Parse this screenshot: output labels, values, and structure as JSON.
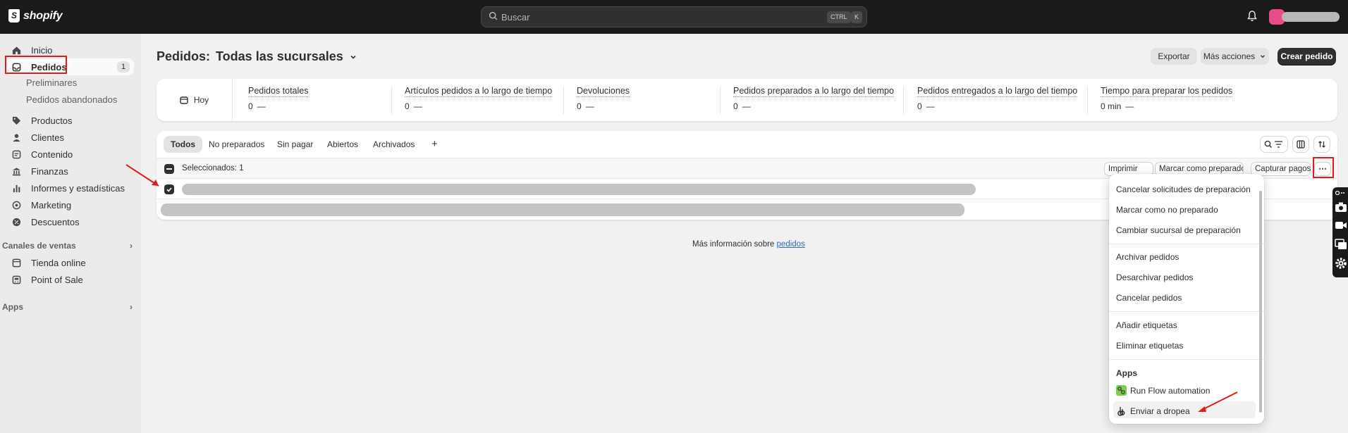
{
  "topbar": {
    "brand": "shopify",
    "search_placeholder": "Buscar",
    "shortcut_ctrl": "CTRL",
    "shortcut_k": "K"
  },
  "sidebar": {
    "items": [
      {
        "label": "Inicio",
        "icon": "home-icon"
      },
      {
        "label": "Pedidos",
        "icon": "inbox-icon",
        "badge": "1",
        "active": true
      },
      {
        "label": "Productos",
        "icon": "tag-icon"
      },
      {
        "label": "Clientes",
        "icon": "person-icon"
      },
      {
        "label": "Contenido",
        "icon": "content-icon"
      },
      {
        "label": "Finanzas",
        "icon": "bank-icon"
      },
      {
        "label": "Informes y estadísticas",
        "icon": "bar-chart-icon"
      },
      {
        "label": "Marketing",
        "icon": "target-icon"
      },
      {
        "label": "Descuentos",
        "icon": "discount-icon"
      }
    ],
    "sub_items": [
      "Preliminares",
      "Pedidos abandonados"
    ],
    "sales_channels_label": "Canales de ventas",
    "channels": [
      {
        "label": "Tienda online",
        "icon": "store-icon"
      },
      {
        "label": "Point of Sale",
        "icon": "pos-icon"
      }
    ],
    "apps_label": "Apps"
  },
  "page": {
    "title": "Pedidos:",
    "location": "Todas las sucursales",
    "export_label": "Exportar",
    "more_actions_label": "Más acciones",
    "create_label": "Crear pedido"
  },
  "metrics": {
    "period": "Hoy",
    "items": [
      {
        "label": "Pedidos totales",
        "value": "0"
      },
      {
        "label": "Artículos pedidos a lo largo de tiempo",
        "value": "0"
      },
      {
        "label": "Devoluciones",
        "value": "0"
      },
      {
        "label": "Pedidos preparados a lo largo del tiempo",
        "value": "0"
      },
      {
        "label": "Pedidos entregados a lo largo del tiempo",
        "value": "0"
      },
      {
        "label": "Tiempo para preparar los pedidos",
        "value": "0 min"
      }
    ]
  },
  "tabs": [
    "Todos",
    "No preparados",
    "Sin pagar",
    "Abiertos",
    "Archivados"
  ],
  "add_tab_label": "+",
  "bulk": {
    "selected_label": "Seleccionados: 1",
    "print_label": "Imprimir",
    "mark_prepared_label": "Marcar como preparado",
    "capture_label": "Capturar pagos"
  },
  "footer_text": "Más información sobre",
  "footer_link": "pedidos",
  "menu": {
    "group1": [
      "Cancelar solicitudes de preparación",
      "Marcar como no preparado",
      "Cambiar sucursal de preparación"
    ],
    "group2": [
      "Archivar pedidos",
      "Desarchivar pedidos",
      "Cancelar pedidos"
    ],
    "group3": [
      "Añadir etiquetas",
      "Eliminar etiquetas"
    ],
    "apps_heading": "Apps",
    "apps": [
      {
        "label": "Run Flow automation",
        "icon": "flow-icon"
      },
      {
        "label": "Enviar a dropea",
        "icon": "dropea-icon"
      }
    ]
  },
  "colors": {
    "topbar": "#1a1a1a",
    "accent_link": "#2c6ecb",
    "annotation": "#e21b1b",
    "primary_button": "#303030"
  }
}
